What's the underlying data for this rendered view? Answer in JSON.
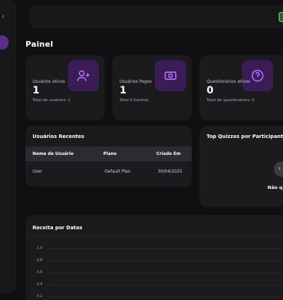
{
  "page": {
    "title": "Painel"
  },
  "stats": [
    {
      "label": "Usuários ativos",
      "value": "1",
      "sub": "Total de usuários: 1",
      "icon": "user-plus-icon"
    },
    {
      "label": "Usuários Pagos",
      "value": "1",
      "sub": "Total 0 Ganhos",
      "icon": "money-icon"
    },
    {
      "label": "Questionários ativos",
      "value": "0",
      "sub": "Total de questionários: 0",
      "icon": "question-circle-icon"
    }
  ],
  "recent_users": {
    "title": "Usuários Recentes",
    "columns": [
      "Nome de Usuário",
      "Plano",
      "Criado Em"
    ],
    "rows": [
      {
        "name": "User",
        "plan": "Default Plan",
        "created": "30/04/2025"
      }
    ]
  },
  "top_quizzes": {
    "title": "Top Quizzes por Participantes",
    "empty_text": "Não q"
  },
  "revenue_chart": {
    "title": "Receita por Datas",
    "y_ticks": [
      "1,0",
      "0,8",
      "0,6",
      "0,4",
      "0,2"
    ]
  },
  "colors": {
    "accent": "#a855f7",
    "accent_bg": "#3a1d57",
    "card": "#1b1b1e",
    "background": "#101012"
  }
}
